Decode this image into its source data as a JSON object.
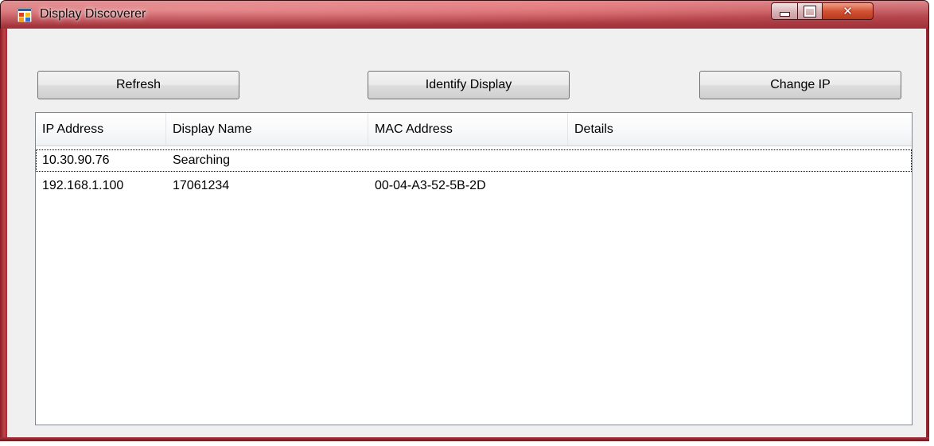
{
  "window": {
    "title": "Display Discoverer"
  },
  "toolbar": {
    "refresh_label": "Refresh",
    "identify_label": "Identify Display",
    "changeip_label": "Change IP"
  },
  "listview": {
    "columns": [
      "IP Address",
      "Display Name",
      "MAC Address",
      "Details"
    ],
    "rows": [
      [
        "10.30.90.76",
        "Searching",
        "",
        ""
      ],
      [
        "192.168.1.100",
        "17061234",
        "00-04-A3-52-5B-2D",
        ""
      ]
    ]
  },
  "icons": {
    "app": "app-window-icon",
    "minimize": "minimize-icon",
    "maximize": "maximize-icon",
    "close": "close-icon"
  },
  "colors": {
    "titlebar": "#b6474f",
    "close_button": "#d45234",
    "client_bg": "#f0f0f0"
  }
}
